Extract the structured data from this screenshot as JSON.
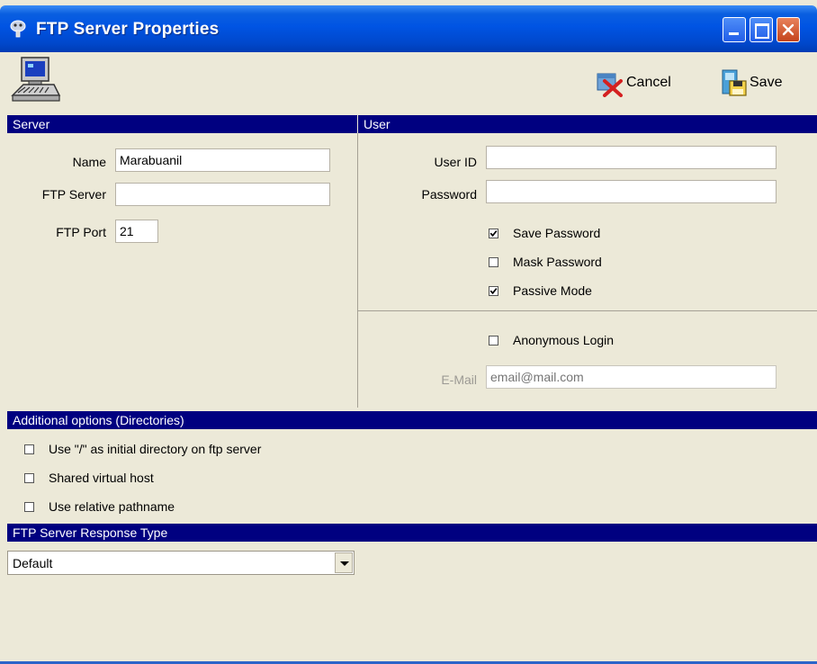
{
  "window": {
    "title": "FTP Server Properties"
  },
  "toolbar": {
    "cancel_label": "Cancel",
    "save_label": "Save"
  },
  "server": {
    "section_title": "Server",
    "name_label": "Name",
    "name_value": "Marabuanil",
    "ftp_server_label": "FTP Server",
    "ftp_server_value": "",
    "ftp_port_label": "FTP Port",
    "ftp_port_value": "21"
  },
  "user": {
    "section_title": "User",
    "user_id_label": "User ID",
    "user_id_value": "",
    "password_label": "Password",
    "password_value": "",
    "save_password_label": "Save Password",
    "save_password_checked": true,
    "mask_password_label": "Mask Password",
    "mask_password_checked": false,
    "passive_mode_label": "Passive Mode",
    "passive_mode_checked": true,
    "anonymous_login_label": "Anonymous Login",
    "anonymous_login_checked": false,
    "email_label": "E-Mail",
    "email_placeholder": "email@mail.com"
  },
  "additional": {
    "section_title": "Additional options (Directories)",
    "use_root_label": "Use \"/\" as initial directory on ftp server",
    "shared_host_label": "Shared virtual host",
    "relative_path_label": "Use relative pathname"
  },
  "response": {
    "section_title": "FTP Server Response Type",
    "selected": "Default"
  },
  "colors": {
    "section_band": "#000080",
    "titlebar": "#0054e3",
    "dialog_bg": "#ece9d8"
  }
}
